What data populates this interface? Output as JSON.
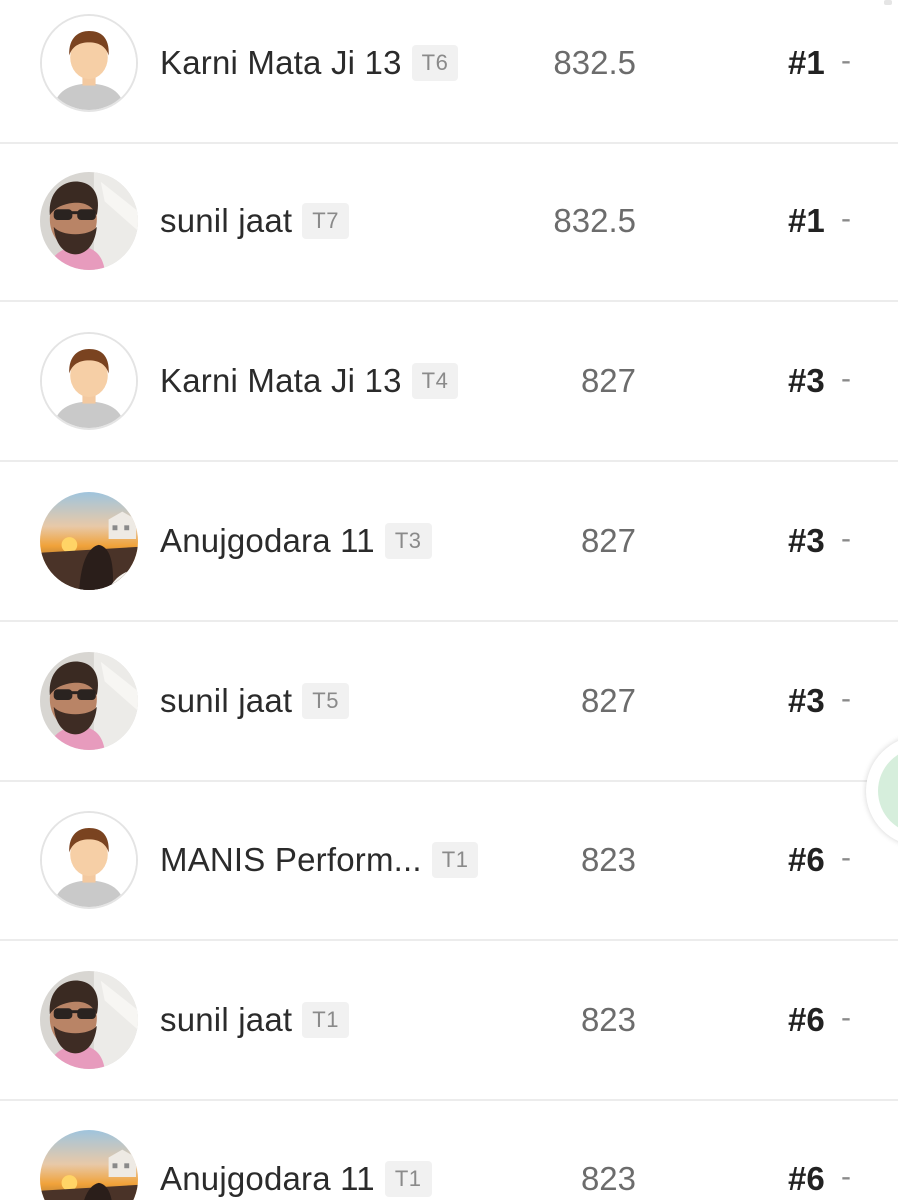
{
  "rows": [
    {
      "name": "Karni Mata Ji 13",
      "team": "T6",
      "points": "832.5",
      "rank": "#1",
      "change": "-",
      "avatar": "default-user-icon"
    },
    {
      "name": "sunil jaat",
      "team": "T7",
      "points": "832.5",
      "rank": "#1",
      "change": "-",
      "avatar": "user-photo-sunglasses"
    },
    {
      "name": "Karni Mata Ji 13",
      "team": "T4",
      "points": "827",
      "rank": "#3",
      "change": "-",
      "avatar": "default-user-icon"
    },
    {
      "name": "Anujgodara 11",
      "team": "T3",
      "points": "827",
      "rank": "#3",
      "change": "-",
      "avatar": "user-photo-sunset"
    },
    {
      "name": "sunil jaat",
      "team": "T5",
      "points": "827",
      "rank": "#3",
      "change": "-",
      "avatar": "user-photo-sunglasses"
    },
    {
      "name": "MANIS Perform...",
      "team": "T1",
      "points": "823",
      "rank": "#6",
      "change": "-",
      "avatar": "default-user-icon"
    },
    {
      "name": "sunil jaat",
      "team": "T1",
      "points": "823",
      "rank": "#6",
      "change": "-",
      "avatar": "user-photo-sunglasses"
    },
    {
      "name": "Anujgodara 11",
      "team": "T1",
      "points": "823",
      "rank": "#6",
      "change": "-",
      "avatar": "user-photo-sunset"
    }
  ],
  "colors": {
    "fab_fill": "#d6eedc",
    "divider": "#ececec",
    "team_badge_bg": "#f1f1f1"
  }
}
